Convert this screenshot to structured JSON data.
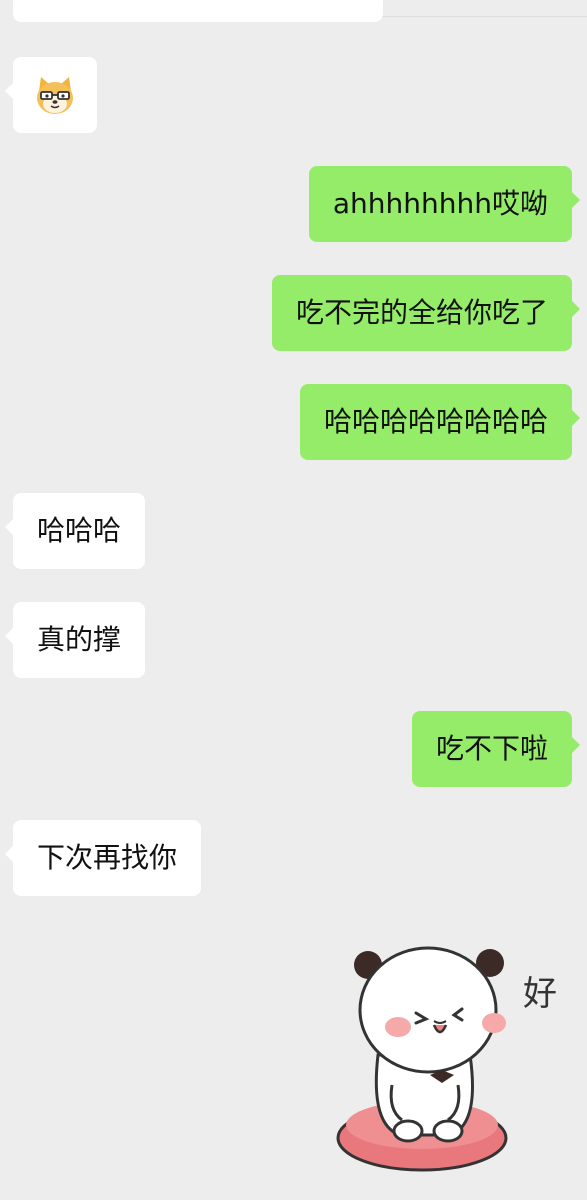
{
  "colors": {
    "background": "#ededed",
    "incoming_bubble": "#ffffff",
    "outgoing_bubble": "#95ec69"
  },
  "messages": [
    {
      "direction": "in",
      "type": "emoji",
      "icon": "doge-face-icon"
    },
    {
      "direction": "out",
      "type": "text",
      "text": "ahhhhhhhh哎呦"
    },
    {
      "direction": "out",
      "type": "text",
      "text": "吃不完的全给你吃了"
    },
    {
      "direction": "out",
      "type": "text",
      "text": "哈哈哈哈哈哈哈哈"
    },
    {
      "direction": "in",
      "type": "text",
      "text": "哈哈哈"
    },
    {
      "direction": "in",
      "type": "text",
      "text": "真的撑"
    },
    {
      "direction": "out",
      "type": "text",
      "text": "吃不下啦"
    },
    {
      "direction": "in",
      "type": "text",
      "text": "下次再找你"
    },
    {
      "direction": "out",
      "type": "sticker",
      "icon": "panda-sticker-icon",
      "sticker_text": "好"
    }
  ]
}
